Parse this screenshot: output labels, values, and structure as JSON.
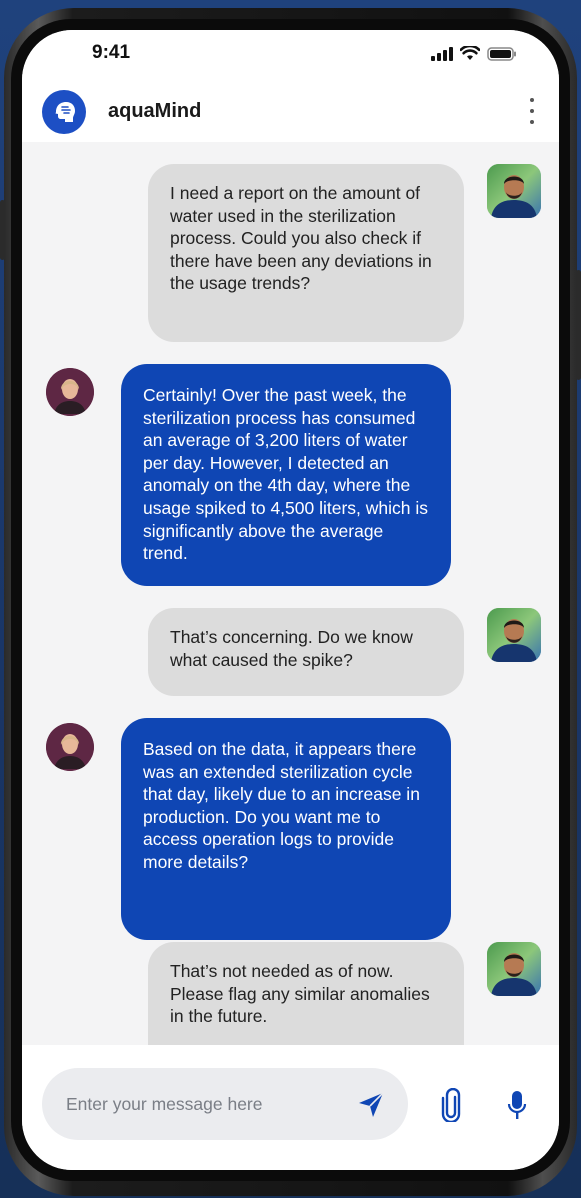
{
  "status_bar": {
    "time": "9:41"
  },
  "header": {
    "app_name": "aquaMind"
  },
  "messages": [
    {
      "role": "user",
      "text": "I need a report on the amount of water used in the sterilization process. Could you also check if there have been any deviations in the usage trends?"
    },
    {
      "role": "bot",
      "text": "Certainly! Over the past week, the sterilization process has consumed an average of 3,200 liters of water per day. However, I detected an anomaly on the 4th day, where the usage spiked to 4,500 liters, which is significantly above the average trend."
    },
    {
      "role": "user",
      "text": "That’s concerning. Do we know what caused the spike?"
    },
    {
      "role": "bot",
      "text": "Based on the data, it appears there was an extended sterilization cycle that day, likely due to an increase in production. Do you want me to access operation logs to provide more details?"
    },
    {
      "role": "user",
      "text": "That’s not needed as of now. Please flag any similar anomalies in the future."
    }
  ],
  "composer": {
    "placeholder": "Enter your message here"
  },
  "colors": {
    "accent": "#0f46b4",
    "user_bubble": "#dcdcdc",
    "background": "#1b3a70"
  }
}
